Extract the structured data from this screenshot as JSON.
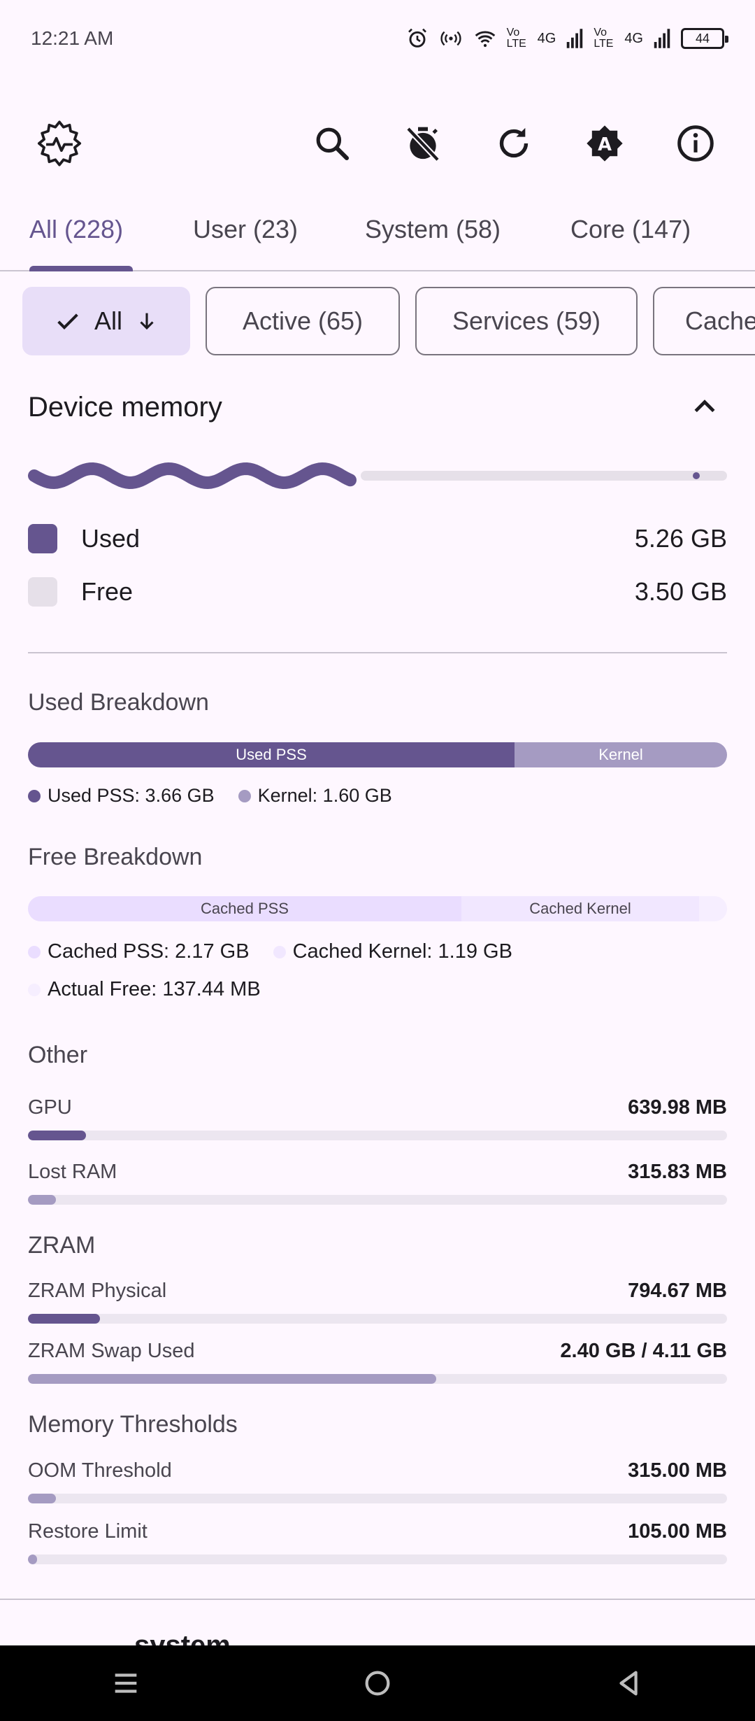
{
  "status": {
    "time": "12:21 AM",
    "battery": "44",
    "network_1": "Vo LTE",
    "network_2": "4G",
    "network_3": "Vo LTE",
    "network_4": "4G"
  },
  "app_bar": {
    "icons": [
      "app-logo-icon",
      "search-icon",
      "timer-off-icon",
      "refresh-icon",
      "auto-brightness-icon",
      "info-icon"
    ]
  },
  "tabs": [
    {
      "label": "All (228)"
    },
    {
      "label": "User (23)"
    },
    {
      "label": "System (58)"
    },
    {
      "label": "Core (147)"
    }
  ],
  "chips": [
    {
      "label": "All"
    },
    {
      "label": "Active (65)"
    },
    {
      "label": "Services (59)"
    },
    {
      "label": "Cache"
    }
  ],
  "device_memory": {
    "title": "Device memory",
    "used_fraction": 0.47,
    "used_label": "Used",
    "used_value": "5.26 GB",
    "free_label": "Free",
    "free_value": "3.50 GB"
  },
  "used_breakdown": {
    "title": "Used Breakdown",
    "seg1_label": "Used PSS",
    "seg1_fraction": 0.696,
    "seg2_label": "Kernel",
    "seg2_fraction": 0.304,
    "legend1": "Used PSS: 3.66 GB",
    "legend2": "Kernel: 1.60 GB"
  },
  "free_breakdown": {
    "title": "Free Breakdown",
    "seg1_label": "Cached PSS",
    "seg1_fraction": 0.62,
    "seg2_label": "Cached Kernel",
    "seg2_fraction": 0.34,
    "seg3_fraction": 0.04,
    "legend1": "Cached PSS: 2.17 GB",
    "legend2": "Cached Kernel: 1.19 GB",
    "legend3": "Actual Free: 137.44 MB"
  },
  "other": {
    "title": "Other",
    "gpu_label": "GPU",
    "gpu_value": "639.98 MB",
    "gpu_fraction": 0.083,
    "lost_label": "Lost RAM",
    "lost_value": "315.83 MB",
    "lost_fraction": 0.04
  },
  "zram": {
    "title": "ZRAM",
    "physical_label": "ZRAM Physical",
    "physical_value": "794.67 MB",
    "physical_fraction": 0.103,
    "swap_label": "ZRAM Swap Used",
    "swap_value": "2.40 GB / 4.11 GB",
    "swap_fraction": 0.584
  },
  "thresholds": {
    "title": "Memory Thresholds",
    "oom_label": "OOM Threshold",
    "oom_value": "315.00 MB",
    "oom_fraction": 0.04,
    "restore_label": "Restore Limit",
    "restore_value": "105.00 MB",
    "restore_fraction": 0.013
  },
  "footer_partial_text": "system",
  "colors": {
    "primary": "#65558F",
    "kernel": "#A59BC2",
    "cached_pss": "#EADDFF",
    "cached_kernel": "#EFE4FF",
    "track": "#E6E0E9",
    "background": "#FEF7FF"
  }
}
